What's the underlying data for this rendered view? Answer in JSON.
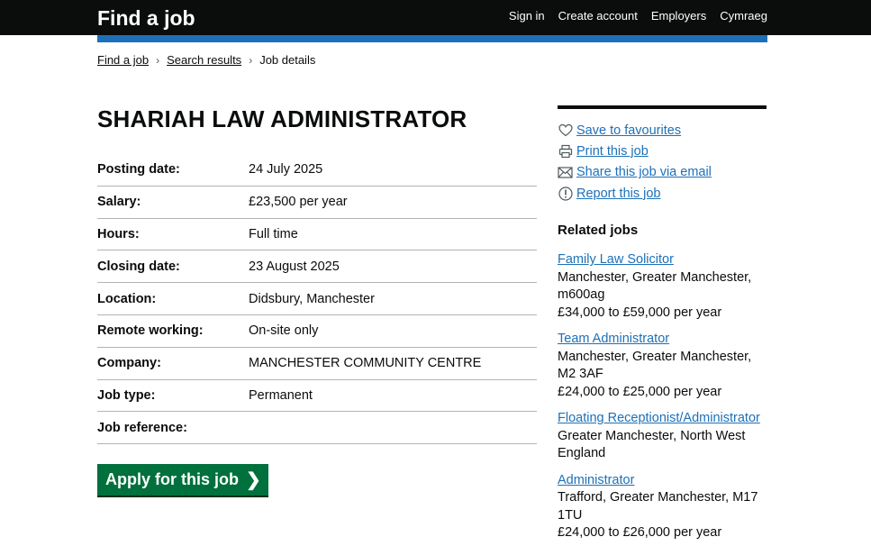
{
  "header": {
    "site_title": "Find a job",
    "nav": [
      "Sign in",
      "Create account",
      "Employers",
      "Cymraeg"
    ]
  },
  "breadcrumb": {
    "items": [
      "Find a job",
      "Search results"
    ],
    "current": "Job details"
  },
  "job": {
    "title": "SHARIAH LAW ADMINISTRATOR",
    "details": [
      {
        "label": "Posting date:",
        "value": "24 July 2025"
      },
      {
        "label": "Salary:",
        "value": "£23,500 per year"
      },
      {
        "label": "Hours:",
        "value": "Full time"
      },
      {
        "label": "Closing date:",
        "value": "23 August 2025"
      },
      {
        "label": "Location:",
        "value": "Didsbury, Manchester"
      },
      {
        "label": "Remote working:",
        "value": "On-site only"
      },
      {
        "label": "Company:",
        "value": "MANCHESTER COMMUNITY CENTRE"
      },
      {
        "label": "Job type:",
        "value": "Permanent"
      },
      {
        "label": "Job reference:",
        "value": ""
      }
    ],
    "apply_label": "Apply for this job"
  },
  "sidebar": {
    "actions": [
      {
        "icon": "heart-icon",
        "label": "Save to favourites"
      },
      {
        "icon": "printer-icon",
        "label": "Print this job"
      },
      {
        "icon": "envelope-icon",
        "label": "Share this job via email"
      },
      {
        "icon": "report-icon",
        "label": "Report this job"
      }
    ],
    "related_heading": "Related jobs",
    "related": [
      {
        "title": "Family Law Solicitor",
        "location": "Manchester, Greater Manchester, m600ag",
        "salary": "£34,000 to £59,000 per year"
      },
      {
        "title": "Team Administrator",
        "location": "Manchester, Greater Manchester, M2 3AF",
        "salary": "£24,000 to £25,000 per year"
      },
      {
        "title": "Floating Receptionist/Administrator",
        "location": "Greater Manchester, North West England",
        "salary": ""
      },
      {
        "title": "Administrator",
        "location": "Trafford, Greater Manchester, M17 1TU",
        "salary": "£24,000 to £26,000 per year"
      }
    ]
  },
  "colors": {
    "header_bg": "#0b0c0c",
    "brand_blue": "#1d70b8",
    "apply_green": "#00703c",
    "link_blue": "#1d70b8"
  }
}
